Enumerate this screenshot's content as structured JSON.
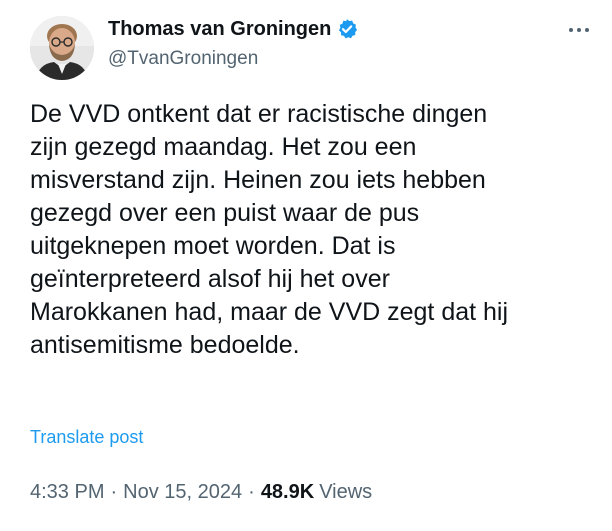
{
  "author": {
    "display_name": "Thomas van Groningen",
    "handle": "@TvanGroningen",
    "verified": true,
    "verified_color": "#1d9bf0"
  },
  "post": {
    "text": "De VVD ontkent dat er racistische dingen\nzijn gezegd maandag. Het zou een\nmisverstand zijn. Heinen zou iets hebben\ngezegd over een puist waar de pus\nuitgeknepen moet worden. Dat is\ngeïnterpreteerd alsof hij het over\nMarokkanen had, maar de VVD zegt dat hij\nantisemitisme bedoelde.",
    "translate_label": "Translate post",
    "time": "4:33 PM",
    "separator": "·",
    "date": "Nov 15, 2024",
    "views_count": "48.9K",
    "views_label": "Views"
  },
  "icons": {
    "more": "more-options-icon",
    "verified": "verified-badge-icon"
  },
  "colors": {
    "link": "#1d9bf0",
    "secondary_text": "#536471",
    "primary_text": "#0f1419"
  }
}
